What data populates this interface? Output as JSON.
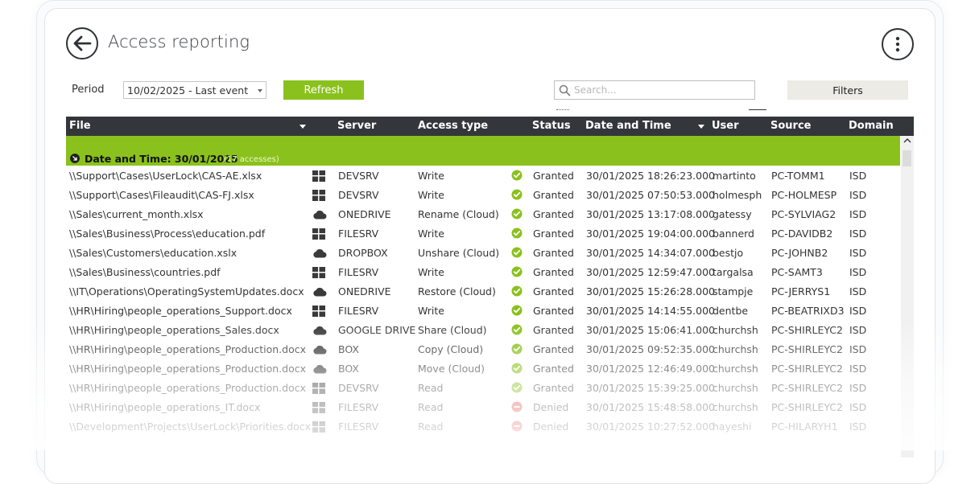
{
  "header": {
    "title": "Access reporting"
  },
  "toolbar": {
    "period_label": "Period",
    "period_value": "10/02/2025 - Last event",
    "refresh_label": "Refresh",
    "search_placeholder": "Search...",
    "filters_label": "Filters"
  },
  "columns": [
    "File",
    "Server",
    "Access type",
    "Status",
    "Date and Time",
    "User",
    "Source",
    "Domain"
  ],
  "group": {
    "title": "Date and Time: 30/01/2025",
    "count": "(17 accesses)"
  },
  "colors": {
    "accent_green": "#8ac11c",
    "header_dark": "#33373c",
    "status_granted": "#8ac11c",
    "status_denied": "#e04a4a"
  },
  "rows": [
    {
      "file": "\\\\Support\\Cases\\UserLock\\CAS-AE.xlsx",
      "server_icon": "windows-icon",
      "server": "DEVSRV",
      "access": "Write",
      "status_icon": "check-icon",
      "status": "Granted",
      "date": "30/01/2025 18:26:23.000",
      "user": "martinto",
      "source": "PC-TOMM1",
      "domain": "ISD"
    },
    {
      "file": "\\\\Support\\Cases\\Fileaudit\\CAS-FJ.xlsx",
      "server_icon": "windows-icon",
      "server": "DEVSRV",
      "access": "Write",
      "status_icon": "check-icon",
      "status": "Granted",
      "date": "30/01/2025 07:50:53.000",
      "user": "holmesph",
      "source": "PC-HOLMESP",
      "domain": "ISD"
    },
    {
      "file": "\\\\Sales\\current_month.xlsx",
      "server_icon": "cloud-icon",
      "server": "ONEDRIVE",
      "access": "Rename (Cloud)",
      "status_icon": "check-icon",
      "status": "Granted",
      "date": "30/01/2025 13:17:08.000",
      "user": "gatessy",
      "source": "PC-SYLVIAG2",
      "domain": "ISD"
    },
    {
      "file": "\\\\Sales\\Business\\Process\\education.pdf",
      "server_icon": "windows-icon",
      "server": "FILESRV",
      "access": "Write",
      "status_icon": "check-icon",
      "status": "Granted",
      "date": "30/01/2025 19:04:00.000",
      "user": "bannerd",
      "source": "PC-DAVIDB2",
      "domain": "ISD"
    },
    {
      "file": "\\\\Sales\\Customers\\education.xslx",
      "server_icon": "cloud-icon",
      "server": "DROPBOX",
      "access": "Unshare (Cloud)",
      "status_icon": "check-icon",
      "status": "Granted",
      "date": "30/01/2025 14:34:07.000",
      "user": "bestjo",
      "source": "PC-JOHNB2",
      "domain": "ISD"
    },
    {
      "file": "\\\\Sales\\Business\\countries.pdf",
      "server_icon": "windows-icon",
      "server": "FILESRV",
      "access": "Write",
      "status_icon": "check-icon",
      "status": "Granted",
      "date": "30/01/2025 12:59:47.000",
      "user": "targalsa",
      "source": "PC-SAMT3",
      "domain": "ISD"
    },
    {
      "file": "\\\\IT\\Operations\\OperatingSystemUpdates.docx",
      "server_icon": "cloud-icon",
      "server": "ONEDRIVE",
      "access": "Restore (Cloud)",
      "status_icon": "check-icon",
      "status": "Granted",
      "date": "30/01/2025 15:26:28.000",
      "user": "stampje",
      "source": "PC-JERRYS1",
      "domain": "ISD"
    },
    {
      "file": "\\\\HR\\Hiring\\people_operations_Support.docx",
      "server_icon": "windows-icon",
      "server": "FILESRV",
      "access": "Write",
      "status_icon": "check-icon",
      "status": "Granted",
      "date": "30/01/2025 14:14:55.000",
      "user": "dentbe",
      "source": "PC-BEATRIXD3",
      "domain": "ISD"
    },
    {
      "file": "\\\\HR\\Hiring\\people_operations_Sales.docx",
      "server_icon": "cloud-icon",
      "server": "GOOGLE DRIVE",
      "access": "Share (Cloud)",
      "status_icon": "check-icon",
      "status": "Granted",
      "date": "30/01/2025 15:06:41.000",
      "user": "churchsh",
      "source": "PC-SHIRLEYC2",
      "domain": "ISD"
    },
    {
      "file": "\\\\HR\\Hiring\\people_operations_Production.docx",
      "server_icon": "cloud-icon",
      "server": "BOX",
      "access": "Copy (Cloud)",
      "status_icon": "check-icon",
      "status": "Granted",
      "date": "30/01/2025 09:52:35.000",
      "user": "churchsh",
      "source": "PC-SHIRLEYC2",
      "domain": "ISD"
    },
    {
      "file": "\\\\HR\\Hiring\\people_operations_Production.docx",
      "server_icon": "cloud-icon",
      "server": "BOX",
      "access": "Move (Cloud)",
      "status_icon": "check-icon",
      "status": "Granted",
      "date": "30/01/2025 12:46:49.000",
      "user": "churchsh",
      "source": "PC-SHIRLEYC2",
      "domain": "ISD"
    },
    {
      "file": "\\\\HR\\Hiring\\people_operations_Production.docx",
      "server_icon": "windows-icon",
      "server": "DEVSRV",
      "access": "Read",
      "status_icon": "check-icon",
      "status": "Granted",
      "date": "30/01/2025 15:39:25.000",
      "user": "churchsh",
      "source": "PC-SHIRLEYC2",
      "domain": "ISD"
    },
    {
      "file": "\\\\HR\\Hiring\\people_operations_IT.docx",
      "server_icon": "windows-icon",
      "server": "FILESRV",
      "access": "Read",
      "status_icon": "denied-icon",
      "status": "Denied",
      "date": "30/01/2025 15:48:58.000",
      "user": "churchsh",
      "source": "PC-SHIRLEYC2",
      "domain": "ISD"
    },
    {
      "file": "\\\\Development\\Projects\\UserLock\\Priorities.docx",
      "server_icon": "windows-icon",
      "server": "FILESRV",
      "access": "Read",
      "status_icon": "denied-icon",
      "status": "Denied",
      "date": "30/01/2025 10:27:52.000",
      "user": "hayeshi",
      "source": "PC-HILARYH1",
      "domain": "ISD"
    }
  ]
}
